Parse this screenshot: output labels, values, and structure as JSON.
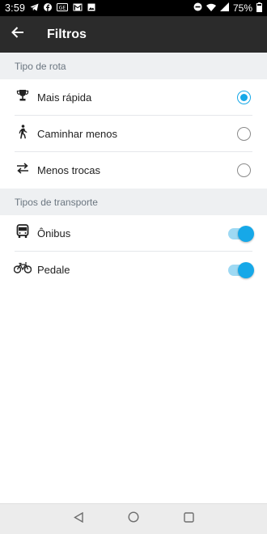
{
  "status_bar": {
    "time": "3:59",
    "battery": "75%",
    "left_icons": [
      "telegram-icon",
      "facebook-icon",
      "news-icon",
      "gmail-icon",
      "image-icon"
    ],
    "right_icons": [
      "dnd-icon",
      "wifi-icon",
      "signal-icon",
      "battery-icon"
    ]
  },
  "app_bar": {
    "title": "Filtros",
    "back_icon": "arrow-back-icon"
  },
  "sections": {
    "route": {
      "header": "Tipo de rota",
      "options": [
        {
          "label": "Mais rápida",
          "icon": "trophy-icon",
          "selected": true
        },
        {
          "label": "Caminhar menos",
          "icon": "walk-icon",
          "selected": false
        },
        {
          "label": "Menos trocas",
          "icon": "swap-icon",
          "selected": false
        }
      ]
    },
    "transport": {
      "header": "Tipos de transporte",
      "options": [
        {
          "label": "Ônibus",
          "icon": "bus-icon",
          "enabled": true
        },
        {
          "label": "Pedale",
          "icon": "bike-icon",
          "enabled": true
        }
      ]
    }
  },
  "accent_color": "#16a8e8",
  "nav_bar": {
    "buttons": [
      "back-triangle-icon",
      "home-circle-icon",
      "recents-square-icon"
    ]
  }
}
